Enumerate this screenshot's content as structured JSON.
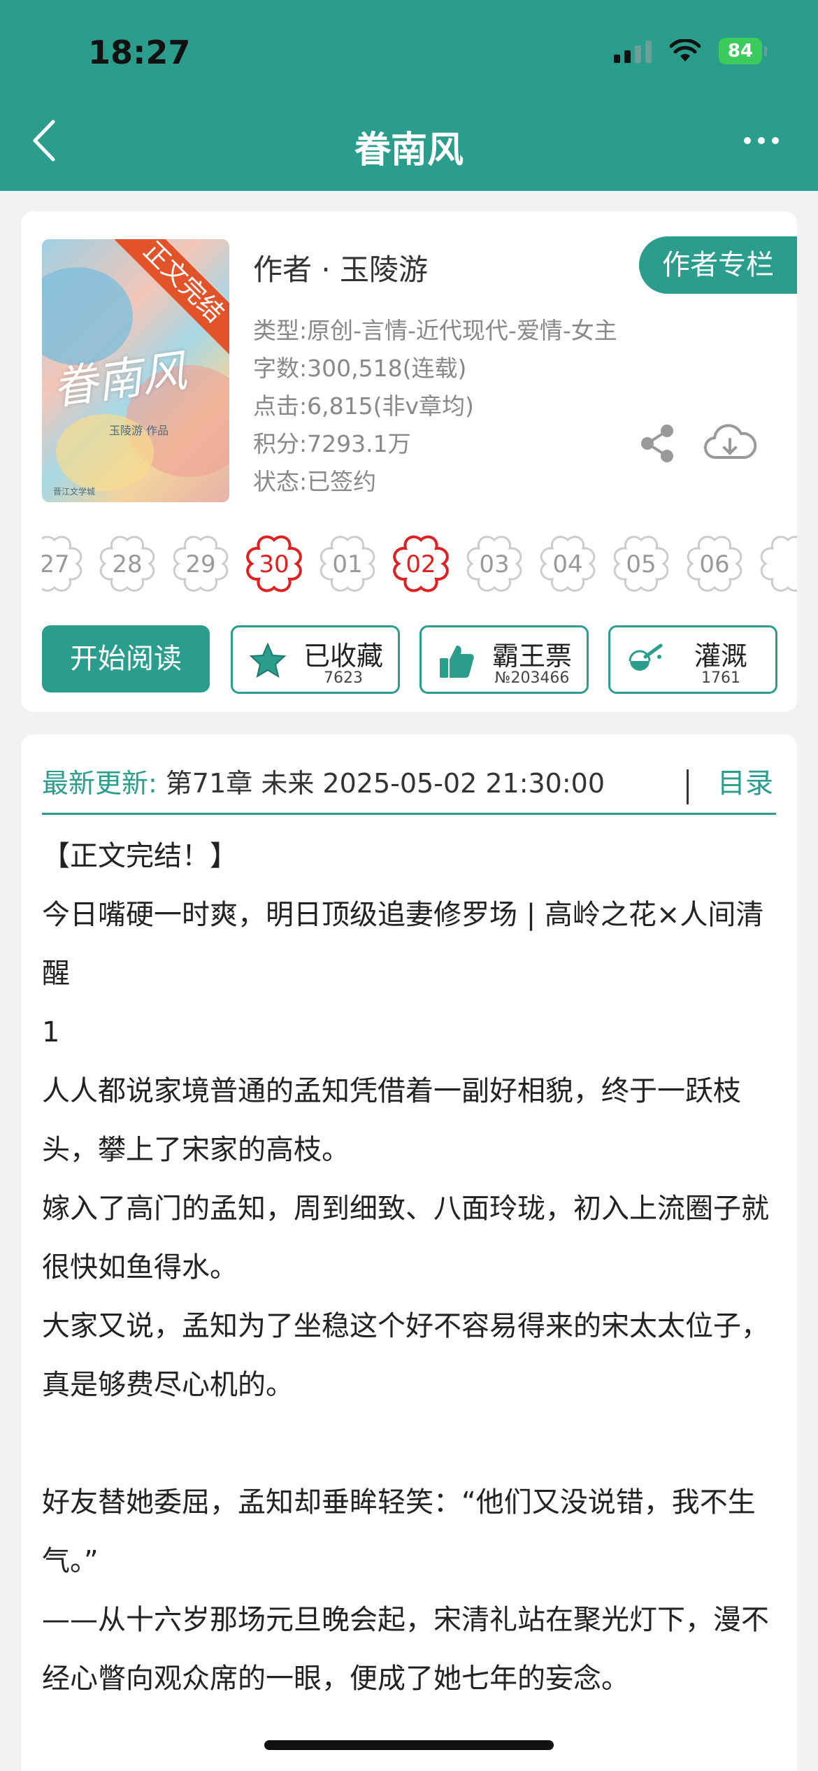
{
  "status_bar": {
    "time": "18:27",
    "battery": "84"
  },
  "nav": {
    "title": "眷南风"
  },
  "cover": {
    "title_art": "眷南风",
    "ribbon": "正文完结",
    "credit": "玉陵游 作品",
    "publisher": "晋江文学城"
  },
  "book": {
    "author_line": "作者 · 玉陵游",
    "author_column_button": "作者专栏",
    "meta": [
      "类型:原创-言情-近代现代-爱情-女主",
      "字数:300,518(连载)",
      "点击:6,815(非v章均)",
      "积分:7293.1万",
      "状态:已签约"
    ]
  },
  "update_days": [
    {
      "label": "27",
      "highlight": false
    },
    {
      "label": "28",
      "highlight": false
    },
    {
      "label": "29",
      "highlight": false
    },
    {
      "label": "30",
      "highlight": true
    },
    {
      "label": "01",
      "highlight": false
    },
    {
      "label": "02",
      "highlight": true
    },
    {
      "label": "03",
      "highlight": false
    },
    {
      "label": "04",
      "highlight": false
    },
    {
      "label": "05",
      "highlight": false
    },
    {
      "label": "06",
      "highlight": false
    }
  ],
  "actions": {
    "start_reading": "开始阅读",
    "favorite": {
      "label": "已收藏",
      "count": "7623"
    },
    "bawangpiao": {
      "label": "霸王票",
      "count": "№203466"
    },
    "irrigate": {
      "label": "灌溉",
      "count": "1761"
    }
  },
  "latest_update": {
    "label": "最新更新:",
    "text": "第71章 未来 2025-05-02 21:30:00",
    "toc": "目录"
  },
  "intro": [
    "【正文完结！】",
    "今日嘴硬一时爽，明日顶级追妻修罗场 | 高岭之花×人间清醒",
    "1",
    "人人都说家境普通的孟知凭借着一副好相貌，终于一跃枝头，攀上了宋家的高枝。",
    "嫁入了高门的孟知，周到细致、八面玲珑，初入上流圈子就很快如鱼得水。",
    "大家又说，孟知为了坐稳这个好不容易得来的宋太太位子，真是够费尽心机的。",
    "",
    "好友替她委屈，孟知却垂眸轻笑：“他们又没说错，我不生气。”",
    "——从十六岁那场元旦晚会起，宋清礼站在聚光灯下，漫不经心瞥向观众席的一眼，便成了她七年的妄念。"
  ],
  "colors": {
    "accent": "#2a9d8c",
    "highlight": "#e02020",
    "ribbon": "#e3532a"
  },
  "icons": [
    "back-chevron-icon",
    "more-dots-icon",
    "share-icon",
    "download-cloud-icon",
    "star-icon",
    "thumbs-up-icon",
    "watering-can-icon",
    "signal-icon",
    "wifi-icon",
    "battery-icon"
  ]
}
